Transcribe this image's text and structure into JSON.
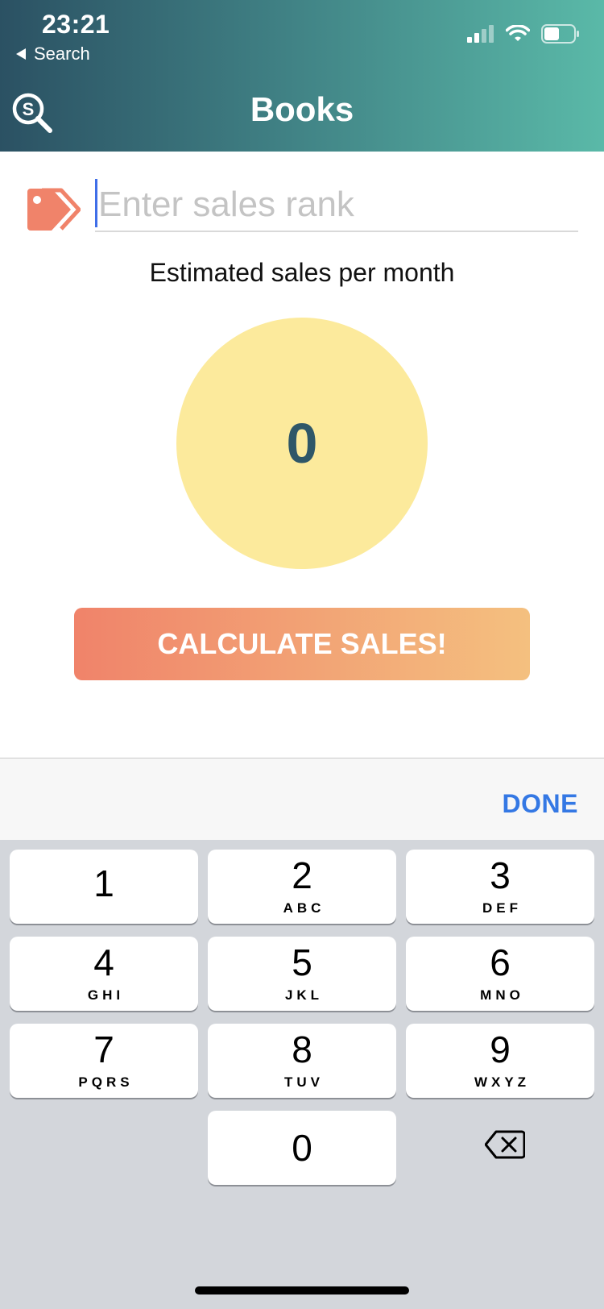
{
  "status_bar": {
    "time": "23:21",
    "back_label": "Search"
  },
  "header": {
    "title": "Books"
  },
  "form": {
    "rank_placeholder": "Enter sales rank",
    "rank_value": ""
  },
  "result": {
    "label": "Estimated sales per month",
    "value": "0"
  },
  "calculate_button": {
    "label": "CALCULATE SALES!"
  },
  "toolbar": {
    "done_label": "DONE"
  },
  "keypad": {
    "keys": [
      {
        "digit": "1",
        "letters": ""
      },
      {
        "digit": "2",
        "letters": "ABC"
      },
      {
        "digit": "3",
        "letters": "DEF"
      },
      {
        "digit": "4",
        "letters": "GHI"
      },
      {
        "digit": "5",
        "letters": "JKL"
      },
      {
        "digit": "6",
        "letters": "MNO"
      },
      {
        "digit": "7",
        "letters": "PQRS"
      },
      {
        "digit": "8",
        "letters": "TUV"
      },
      {
        "digit": "9",
        "letters": "WXYZ"
      },
      {
        "digit": "0",
        "letters": ""
      }
    ],
    "delete_icon": "backspace-icon"
  },
  "colors": {
    "header_start": "#2b5163",
    "header_end": "#5ab9a8",
    "accent_orange": "#f0836a",
    "circle_fill": "#fcea9c",
    "done_blue": "#3478e4"
  }
}
